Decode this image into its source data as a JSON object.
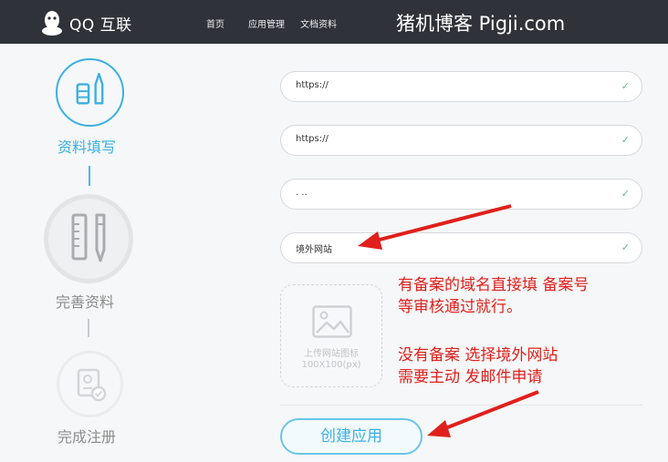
{
  "header": {
    "logo_text": "QQ 互联",
    "nav": {
      "home": "首页",
      "apps": "应用管理",
      "docs": "文档资料"
    },
    "watermark": "猪机博客 Pigji.com"
  },
  "steps": [
    {
      "label": "资料填写",
      "icon": "pen-tools-icon",
      "state": "active"
    },
    {
      "label": "完善资料",
      "icon": "ruler-pen-icon",
      "state": "inactive"
    },
    {
      "label": "完成注册",
      "icon": "certificate-icon",
      "state": "inactive"
    }
  ],
  "form": {
    "fields": [
      {
        "value": "https://",
        "check": "✓"
      },
      {
        "value": "https://",
        "check": "✓"
      },
      {
        "value": ". ..",
        "check": "✓"
      },
      {
        "value": "境外网站",
        "check": "✓"
      }
    ],
    "upload": {
      "hint_line1": "上传网站图标",
      "hint_line2": "100X100(px)",
      "icon": "image-icon"
    },
    "create_button": "创建应用"
  },
  "annotations": {
    "note1_line1": "有备案的域名直接填 备案号",
    "note1_line2": "等审核通过就行。",
    "note2_line1": "没有备案 选择境外网站",
    "note2_line2": "需要主动 发邮件申请"
  },
  "colors": {
    "topbar": "#2f3238",
    "accent": "#3ab0e2",
    "check": "#5cbf83",
    "annotation": "#e0201c"
  }
}
